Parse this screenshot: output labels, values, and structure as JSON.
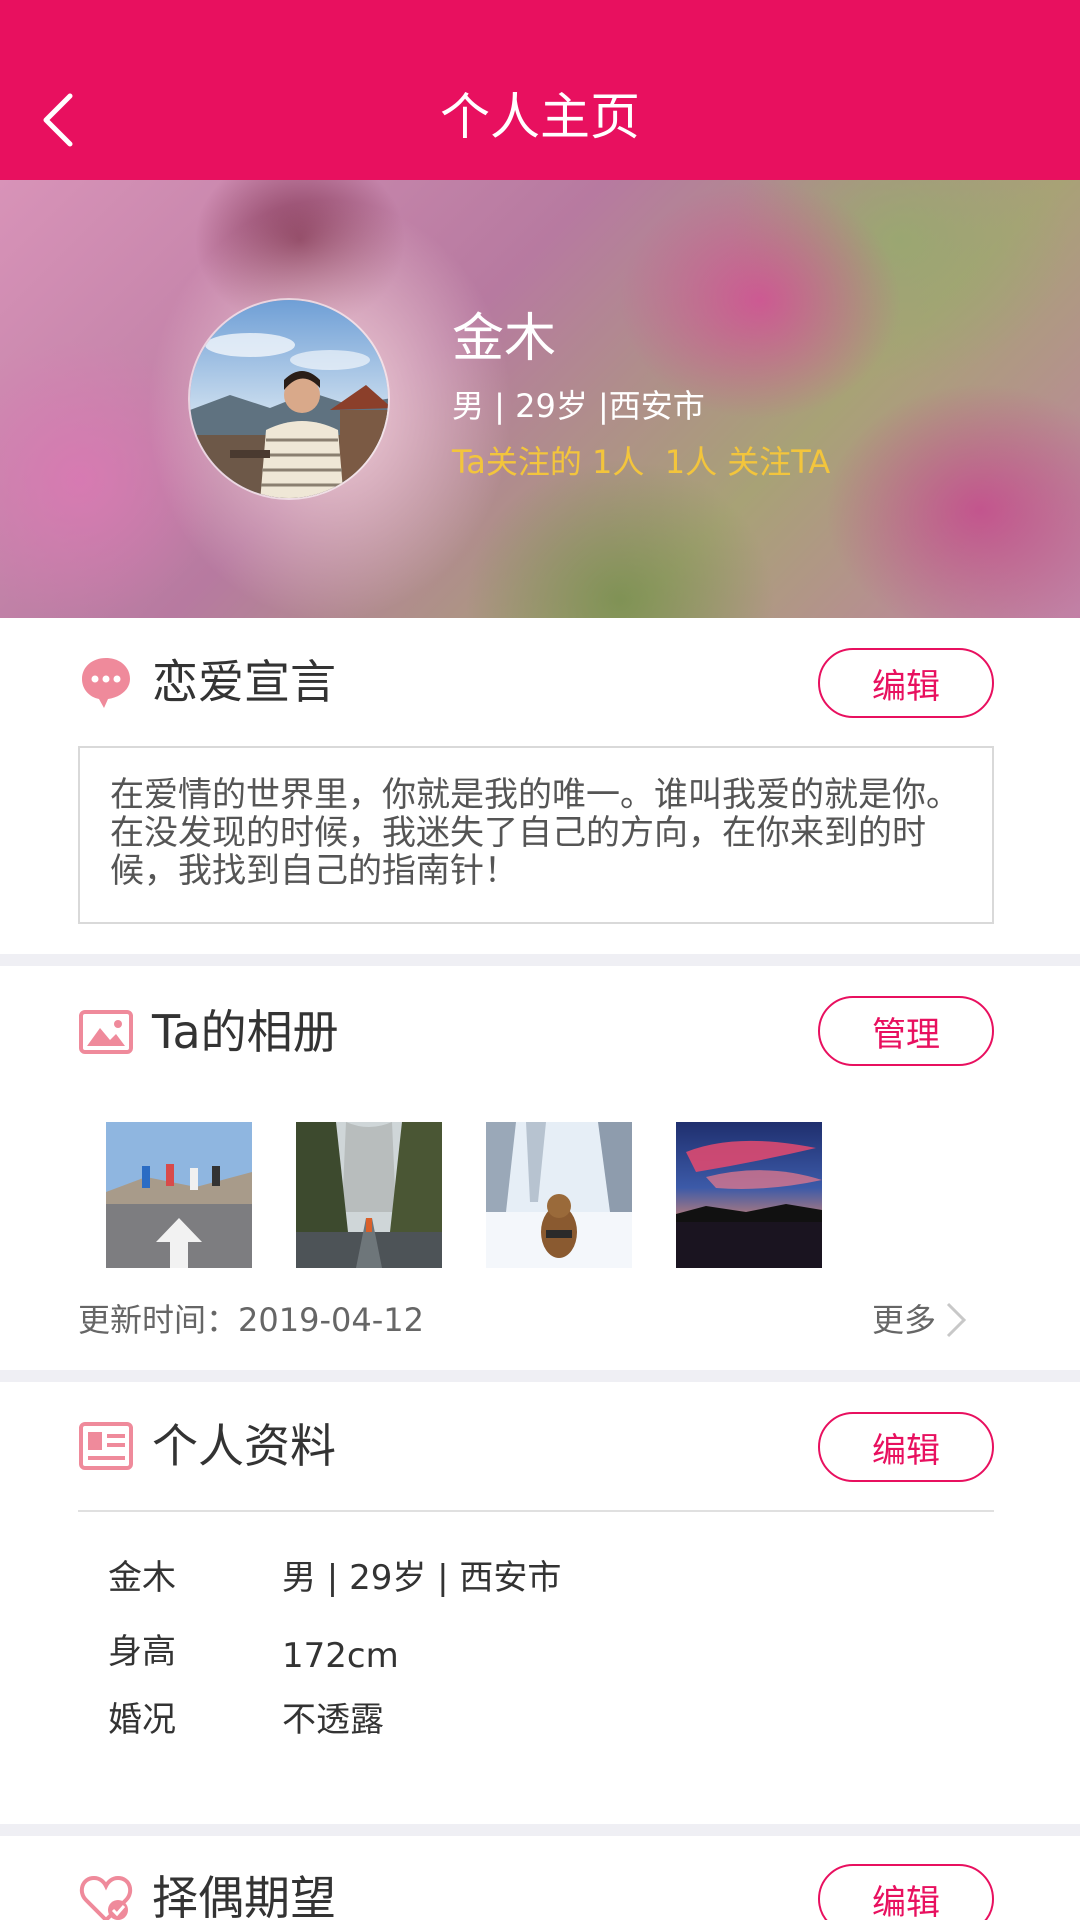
{
  "nav": {
    "title": "个人主页"
  },
  "profile": {
    "name": "金木",
    "meta": "男 | 29岁 |西安市",
    "follow": "Ta关注的 1人  1人 关注TA"
  },
  "declaration": {
    "title": "恋爱宣言",
    "button": "编辑",
    "text": "在爱情的世界里，你就是我的唯一。谁叫我爱的就是你。在没发现的时候，我迷失了自己的方向，在你来到的时候，我找到自己的指南针！"
  },
  "album": {
    "title": "Ta的相册",
    "button": "管理",
    "update": "更新时间：2019-04-12",
    "more": "更多"
  },
  "info": {
    "title": "个人资料",
    "button": "编辑",
    "rows": [
      {
        "label": "金木",
        "value": "男 | 29岁 | 西安市"
      },
      {
        "label": "身高",
        "value": "172cm"
      },
      {
        "label": "婚况",
        "value": "不透露"
      }
    ]
  },
  "expect": {
    "title": "择偶期望",
    "button": "编辑"
  },
  "colors": {
    "accent": "#e8105f",
    "follow": "#f3c53c",
    "icon": "#ef8a9b"
  }
}
